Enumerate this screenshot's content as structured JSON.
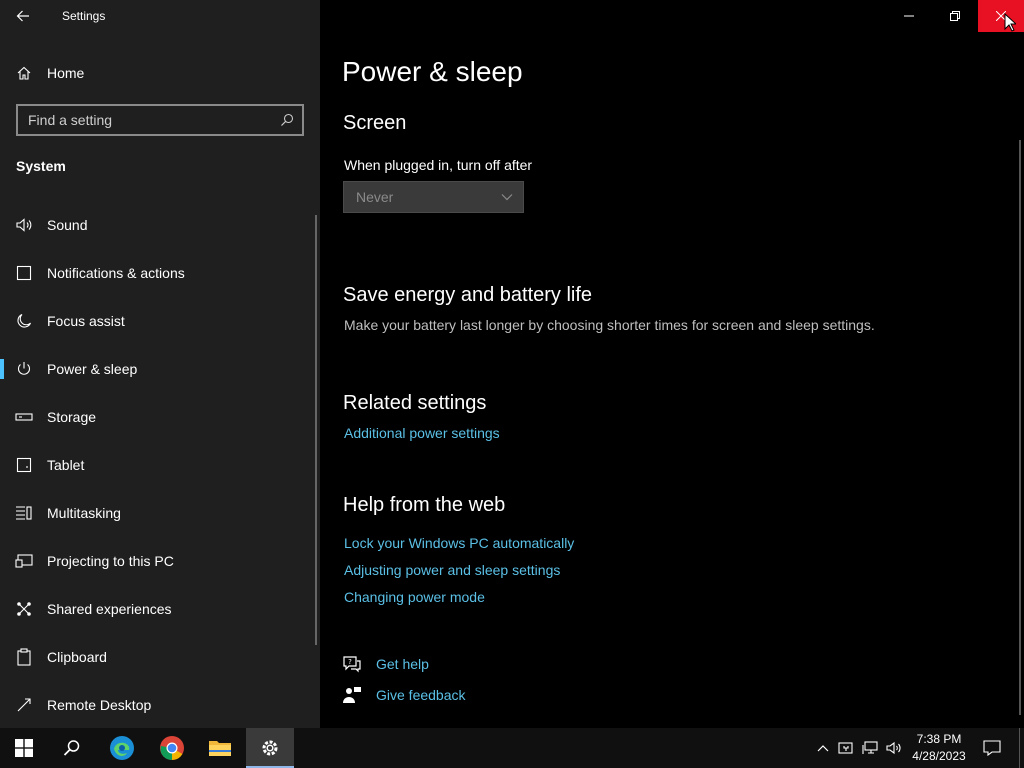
{
  "window": {
    "title": "Settings"
  },
  "sidebar": {
    "home_label": "Home",
    "search_placeholder": "Find a setting",
    "section_title": "System",
    "items": [
      {
        "label": "Sound",
        "icon": "speaker-icon"
      },
      {
        "label": "Notifications & actions",
        "icon": "notification-icon"
      },
      {
        "label": "Focus assist",
        "icon": "moon-icon"
      },
      {
        "label": "Power & sleep",
        "icon": "power-icon",
        "active": true
      },
      {
        "label": "Storage",
        "icon": "storage-icon"
      },
      {
        "label": "Tablet",
        "icon": "tablet-icon"
      },
      {
        "label": "Multitasking",
        "icon": "multitasking-icon"
      },
      {
        "label": "Projecting to this PC",
        "icon": "projecting-icon"
      },
      {
        "label": "Shared experiences",
        "icon": "shared-icon"
      },
      {
        "label": "Clipboard",
        "icon": "clipboard-icon"
      },
      {
        "label": "Remote Desktop",
        "icon": "remote-desktop-icon"
      }
    ]
  },
  "main": {
    "page_title": "Power & sleep",
    "screen": {
      "heading": "Screen",
      "plugged_label": "When plugged in, turn off after",
      "plugged_value": "Never"
    },
    "energy": {
      "heading": "Save energy and battery life",
      "description": "Make your battery last longer by choosing shorter times for screen and sleep settings."
    },
    "related": {
      "heading": "Related settings",
      "link": "Additional power settings"
    },
    "help": {
      "heading": "Help from the web",
      "links": [
        "Lock your Windows PC automatically",
        "Adjusting power and sleep settings",
        "Changing power mode"
      ]
    },
    "get_help": "Get help",
    "give_feedback": "Give feedback"
  },
  "taskbar": {
    "time": "7:38 PM",
    "date": "4/28/2023"
  },
  "colors": {
    "accent": "#4cc2ff",
    "link": "#5bc0e6",
    "close": "#e81123"
  }
}
